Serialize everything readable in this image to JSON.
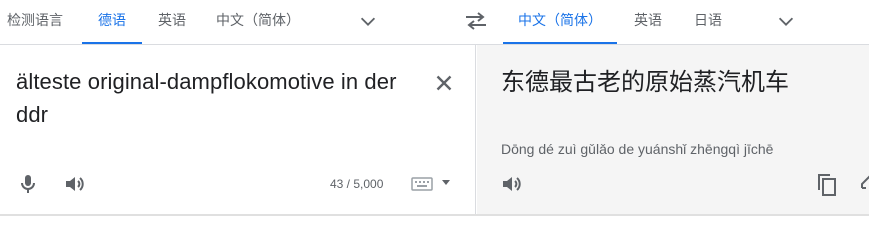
{
  "source_languages": {
    "tabs": [
      {
        "label": "检测语言",
        "active": false
      },
      {
        "label": "德语",
        "active": true
      },
      {
        "label": "英语",
        "active": false
      },
      {
        "label": "中文（简体）",
        "active": false
      }
    ],
    "more_icon": "chevron-down-icon"
  },
  "swap_icon": "swap-horiz-icon",
  "target_languages": {
    "tabs": [
      {
        "label": "中文（简体）",
        "active": true
      },
      {
        "label": "英语",
        "active": false
      },
      {
        "label": "日语",
        "active": false
      }
    ],
    "more_icon": "chevron-down-icon"
  },
  "source": {
    "text": "älteste original-dampflokomotive in der ddr",
    "char_count": "43 / 5,000",
    "icons": [
      "close-icon",
      "mic-icon",
      "volume-icon",
      "keyboard-icon",
      "caret-down-icon"
    ]
  },
  "target": {
    "text": "东德最古老的原始蒸汽机车",
    "pinyin": "Dōng dé zuì gǔlǎo de yuánshǐ zhēngqì jīchē",
    "icons": [
      "volume-icon",
      "copy-icon",
      "edit-icon"
    ]
  },
  "colors": {
    "accent": "#1a73e8",
    "muted": "#5f6368",
    "text": "#202124",
    "divider": "#dadce0",
    "target_bg": "#f5f5f5"
  }
}
